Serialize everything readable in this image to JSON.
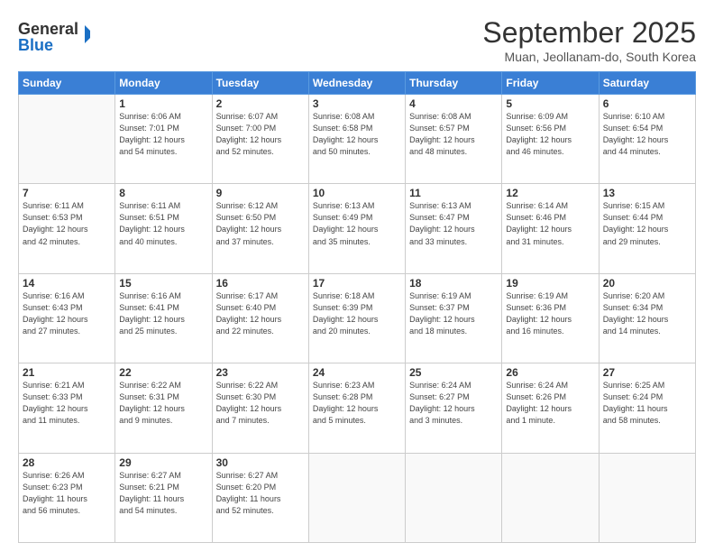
{
  "header": {
    "logo_line1": "General",
    "logo_line2": "Blue",
    "month": "September 2025",
    "location": "Muan, Jeollanam-do, South Korea"
  },
  "days_of_week": [
    "Sunday",
    "Monday",
    "Tuesday",
    "Wednesday",
    "Thursday",
    "Friday",
    "Saturday"
  ],
  "weeks": [
    [
      {
        "day": "",
        "info": ""
      },
      {
        "day": "1",
        "info": "Sunrise: 6:06 AM\nSunset: 7:01 PM\nDaylight: 12 hours\nand 54 minutes."
      },
      {
        "day": "2",
        "info": "Sunrise: 6:07 AM\nSunset: 7:00 PM\nDaylight: 12 hours\nand 52 minutes."
      },
      {
        "day": "3",
        "info": "Sunrise: 6:08 AM\nSunset: 6:58 PM\nDaylight: 12 hours\nand 50 minutes."
      },
      {
        "day": "4",
        "info": "Sunrise: 6:08 AM\nSunset: 6:57 PM\nDaylight: 12 hours\nand 48 minutes."
      },
      {
        "day": "5",
        "info": "Sunrise: 6:09 AM\nSunset: 6:56 PM\nDaylight: 12 hours\nand 46 minutes."
      },
      {
        "day": "6",
        "info": "Sunrise: 6:10 AM\nSunset: 6:54 PM\nDaylight: 12 hours\nand 44 minutes."
      }
    ],
    [
      {
        "day": "7",
        "info": "Sunrise: 6:11 AM\nSunset: 6:53 PM\nDaylight: 12 hours\nand 42 minutes."
      },
      {
        "day": "8",
        "info": "Sunrise: 6:11 AM\nSunset: 6:51 PM\nDaylight: 12 hours\nand 40 minutes."
      },
      {
        "day": "9",
        "info": "Sunrise: 6:12 AM\nSunset: 6:50 PM\nDaylight: 12 hours\nand 37 minutes."
      },
      {
        "day": "10",
        "info": "Sunrise: 6:13 AM\nSunset: 6:49 PM\nDaylight: 12 hours\nand 35 minutes."
      },
      {
        "day": "11",
        "info": "Sunrise: 6:13 AM\nSunset: 6:47 PM\nDaylight: 12 hours\nand 33 minutes."
      },
      {
        "day": "12",
        "info": "Sunrise: 6:14 AM\nSunset: 6:46 PM\nDaylight: 12 hours\nand 31 minutes."
      },
      {
        "day": "13",
        "info": "Sunrise: 6:15 AM\nSunset: 6:44 PM\nDaylight: 12 hours\nand 29 minutes."
      }
    ],
    [
      {
        "day": "14",
        "info": "Sunrise: 6:16 AM\nSunset: 6:43 PM\nDaylight: 12 hours\nand 27 minutes."
      },
      {
        "day": "15",
        "info": "Sunrise: 6:16 AM\nSunset: 6:41 PM\nDaylight: 12 hours\nand 25 minutes."
      },
      {
        "day": "16",
        "info": "Sunrise: 6:17 AM\nSunset: 6:40 PM\nDaylight: 12 hours\nand 22 minutes."
      },
      {
        "day": "17",
        "info": "Sunrise: 6:18 AM\nSunset: 6:39 PM\nDaylight: 12 hours\nand 20 minutes."
      },
      {
        "day": "18",
        "info": "Sunrise: 6:19 AM\nSunset: 6:37 PM\nDaylight: 12 hours\nand 18 minutes."
      },
      {
        "day": "19",
        "info": "Sunrise: 6:19 AM\nSunset: 6:36 PM\nDaylight: 12 hours\nand 16 minutes."
      },
      {
        "day": "20",
        "info": "Sunrise: 6:20 AM\nSunset: 6:34 PM\nDaylight: 12 hours\nand 14 minutes."
      }
    ],
    [
      {
        "day": "21",
        "info": "Sunrise: 6:21 AM\nSunset: 6:33 PM\nDaylight: 12 hours\nand 11 minutes."
      },
      {
        "day": "22",
        "info": "Sunrise: 6:22 AM\nSunset: 6:31 PM\nDaylight: 12 hours\nand 9 minutes."
      },
      {
        "day": "23",
        "info": "Sunrise: 6:22 AM\nSunset: 6:30 PM\nDaylight: 12 hours\nand 7 minutes."
      },
      {
        "day": "24",
        "info": "Sunrise: 6:23 AM\nSunset: 6:28 PM\nDaylight: 12 hours\nand 5 minutes."
      },
      {
        "day": "25",
        "info": "Sunrise: 6:24 AM\nSunset: 6:27 PM\nDaylight: 12 hours\nand 3 minutes."
      },
      {
        "day": "26",
        "info": "Sunrise: 6:24 AM\nSunset: 6:26 PM\nDaylight: 12 hours\nand 1 minute."
      },
      {
        "day": "27",
        "info": "Sunrise: 6:25 AM\nSunset: 6:24 PM\nDaylight: 11 hours\nand 58 minutes."
      }
    ],
    [
      {
        "day": "28",
        "info": "Sunrise: 6:26 AM\nSunset: 6:23 PM\nDaylight: 11 hours\nand 56 minutes."
      },
      {
        "day": "29",
        "info": "Sunrise: 6:27 AM\nSunset: 6:21 PM\nDaylight: 11 hours\nand 54 minutes."
      },
      {
        "day": "30",
        "info": "Sunrise: 6:27 AM\nSunset: 6:20 PM\nDaylight: 11 hours\nand 52 minutes."
      },
      {
        "day": "",
        "info": ""
      },
      {
        "day": "",
        "info": ""
      },
      {
        "day": "",
        "info": ""
      },
      {
        "day": "",
        "info": ""
      }
    ]
  ]
}
